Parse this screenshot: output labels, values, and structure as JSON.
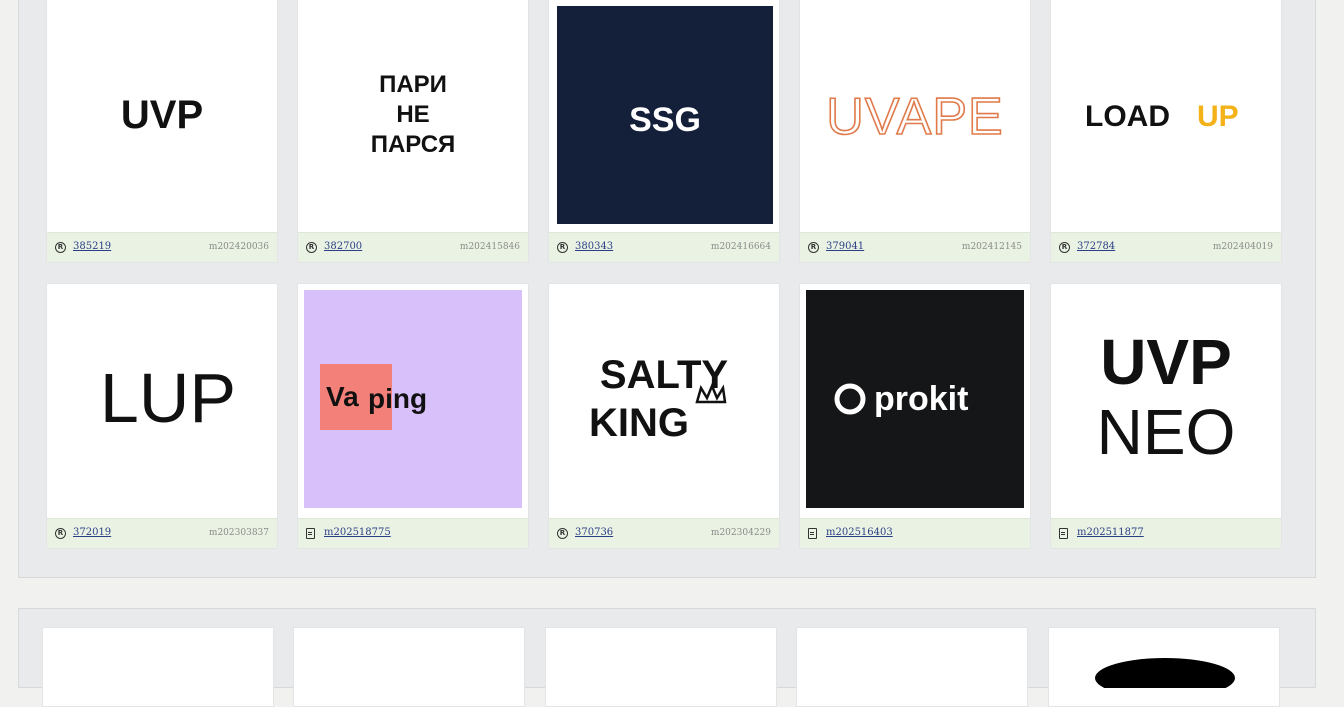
{
  "cards": [
    {
      "logo_text": "UVP",
      "footer_id": "385219",
      "footer_mid": "m202420036",
      "footer_icon": "registered-icon"
    },
    {
      "logo_lines": [
        "ПАРИ",
        "НЕ",
        "ПАРСЯ"
      ],
      "footer_id": "382700",
      "footer_mid": "m202415846",
      "footer_icon": "registered-icon"
    },
    {
      "logo_text": "SSG",
      "footer_id": "380343",
      "footer_mid": "m202416664",
      "footer_icon": "registered-icon",
      "bg": "#141f3a"
    },
    {
      "logo_text": "UVAPE",
      "footer_id": "379041",
      "footer_mid": "m202412145",
      "footer_icon": "registered-icon",
      "color": "#e07a4a"
    },
    {
      "logo_text_a": "LOAD",
      "logo_text_b": "UP",
      "footer_id": "372784",
      "footer_mid": "m202404019",
      "footer_icon": "registered-icon",
      "accent": "#f3b318"
    },
    {
      "logo_text": "LUP",
      "footer_id": "372019",
      "footer_mid": "m202303837",
      "footer_icon": "registered-icon"
    },
    {
      "logo_text_a": "Va",
      "logo_text_b": "ping",
      "footer_id": "m202518775",
      "footer_icon": "document-icon",
      "bg": "#d8c1fb",
      "accent": "#f4807a"
    },
    {
      "logo_lines": [
        "SALTY",
        "KING"
      ],
      "footer_id": "370736",
      "footer_mid": "m202304229",
      "footer_icon": "registered-icon"
    },
    {
      "logo_text": "prokit",
      "footer_id": "m202516403",
      "footer_icon": "document-icon",
      "bg": "#151617"
    },
    {
      "logo_lines": [
        "UVP",
        "NEO"
      ],
      "footer_id": "m202511877",
      "footer_icon": "document-icon"
    }
  ]
}
